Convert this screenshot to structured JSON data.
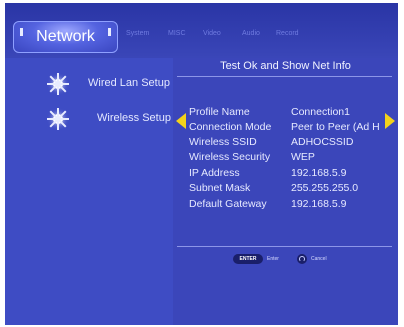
{
  "header": {
    "active_tab": "Network",
    "faint_tabs": [
      "System",
      "MISC",
      "Video",
      "Audio",
      "Record"
    ]
  },
  "sidebar": {
    "items": [
      {
        "label": "Wired Lan Setup",
        "icon": "sun-icon"
      },
      {
        "label": "Wireless Setup",
        "icon": "sun-icon"
      }
    ]
  },
  "content": {
    "title": "Test Ok and Show Net Info",
    "rows": [
      {
        "key": "Profile Name",
        "value": "Connection1"
      },
      {
        "key": "Connection Mode",
        "value": "Peer to Peer (Ad H"
      },
      {
        "key": "Wireless SSID",
        "value": "ADHOCSSID"
      },
      {
        "key": "Wireless Security",
        "value": "WEP"
      },
      {
        "key": "IP Address",
        "value": "192.168.5.9"
      },
      {
        "key": "Subnet Mask",
        "value": "255.255.255.0"
      },
      {
        "key": "Default Gateway",
        "value": "192.168.5.9"
      }
    ]
  },
  "legend": {
    "enter_key": "ENTER",
    "enter_label": "Enter",
    "cancel_label": "Cancel"
  },
  "colors": {
    "background": "#3a46b8",
    "sidebar": "#3e4cc4",
    "arrow": "#f3d21a"
  }
}
